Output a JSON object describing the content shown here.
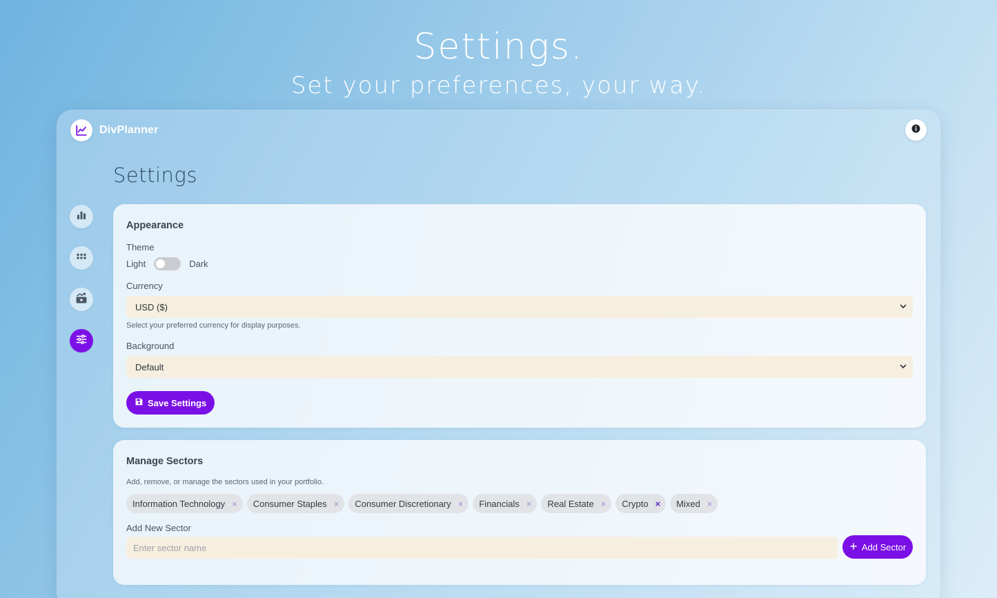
{
  "hero": {
    "title": "Settings.",
    "subtitle": "Set your preferences, your way."
  },
  "brand": {
    "name": "DivPlanner",
    "icon": "chart-line-icon"
  },
  "header": {
    "info_icon": "info-icon"
  },
  "page": {
    "title": "Settings"
  },
  "sidebar": {
    "items": [
      {
        "name": "dashboard",
        "icon": "bar-chart-icon",
        "active": false
      },
      {
        "name": "holdings",
        "icon": "grid-dots-icon",
        "active": false
      },
      {
        "name": "dividends",
        "icon": "money-growth-icon",
        "active": false
      },
      {
        "name": "settings",
        "icon": "sliders-icon",
        "active": true
      }
    ]
  },
  "appearance": {
    "title": "Appearance",
    "theme_label": "Theme",
    "theme_light": "Light",
    "theme_dark": "Dark",
    "theme_dark_enabled": false,
    "currency_label": "Currency",
    "currency_value": "USD ($)",
    "currency_hint": "Select your preferred currency for display purposes.",
    "background_label": "Background",
    "background_value": "Default",
    "save_label": "Save Settings"
  },
  "sectors": {
    "title": "Manage Sectors",
    "hint": "Add, remove, or manage the sectors used in your portfolio.",
    "items": [
      "Information Technology",
      "Consumer Staples",
      "Consumer Discretionary",
      "Financials",
      "Real Estate",
      "Crypto",
      "Mixed"
    ],
    "remove_glyph": "×",
    "add_label": "Add New Sector",
    "input_placeholder": "Enter sector name",
    "add_button": "Add Sector"
  },
  "colors": {
    "accent": "#7b10e6",
    "input_bg": "#f6efe0",
    "chip_bg": "#e1e3e7"
  }
}
